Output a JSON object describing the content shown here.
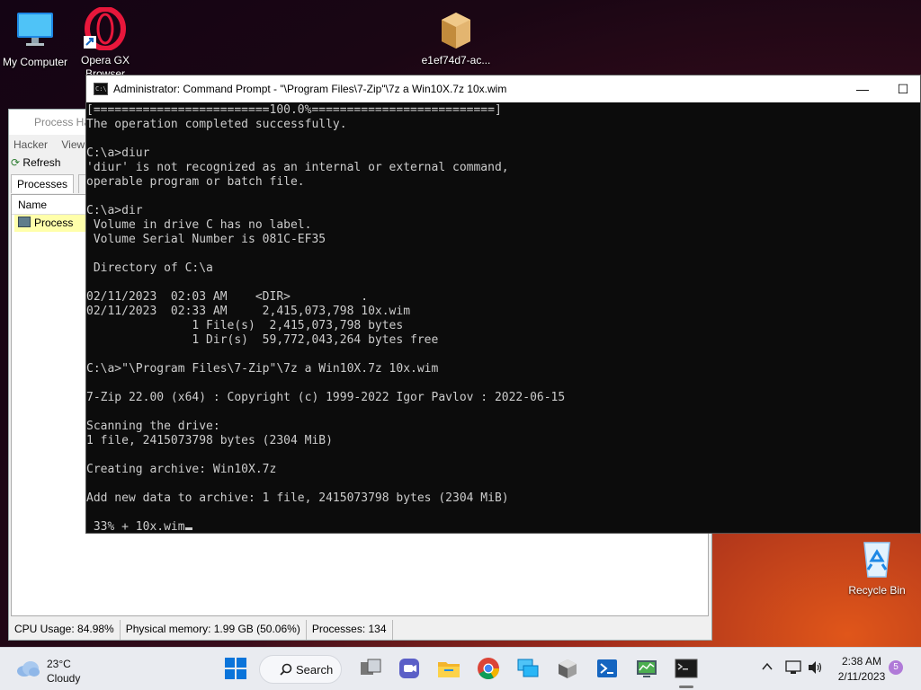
{
  "desktop": {
    "icons": [
      {
        "label": "My Computer",
        "icon": "monitor-icon"
      },
      {
        "label": "Opera GX\nBrowser",
        "icon": "opera-icon"
      },
      {
        "label": "e1ef74d7-ac...",
        "icon": "package-box-icon"
      },
      {
        "label": "Recycle Bin",
        "icon": "recycle-bin-icon"
      }
    ]
  },
  "process_hacker": {
    "title": "Process Ha",
    "menu": [
      "Hacker",
      "View"
    ],
    "toolbar_refresh": "Refresh",
    "tabs": [
      "Processes",
      "Ser"
    ],
    "column_name": "Name",
    "row_label": "Process",
    "status": {
      "cpu": "CPU Usage: 84.98%",
      "memory": "Physical memory: 1.99 GB (50.06%)",
      "processes": "Processes: 134"
    }
  },
  "cmd": {
    "title": "Administrator:  Command Prompt - \"\\Program Files\\7-Zip\"\\7z  a Win10X.7z 10x.wim",
    "minimize": "—",
    "maximize": "☐",
    "lines": [
      "[=========================100.0%==========================]",
      "The operation completed successfully.",
      "",
      "C:\\a>diur",
      "'diur' is not recognized as an internal or external command,",
      "operable program or batch file.",
      "",
      "C:\\a>dir",
      " Volume in drive C has no label.",
      " Volume Serial Number is 081C-EF35",
      "",
      " Directory of C:\\a",
      "",
      "02/11/2023  02:03 AM    <DIR>          .",
      "02/11/2023  02:33 AM     2,415,073,798 10x.wim",
      "               1 File(s)  2,415,073,798 bytes",
      "               1 Dir(s)  59,772,043,264 bytes free",
      "",
      "C:\\a>\"\\Program Files\\7-Zip\"\\7z a Win10X.7z 10x.wim",
      "",
      "7-Zip 22.00 (x64) : Copyright (c) 1999-2022 Igor Pavlov : 2022-06-15",
      "",
      "Scanning the drive:",
      "1 file, 2415073798 bytes (2304 MiB)",
      "",
      "Creating archive: Win10X.7z",
      "",
      "Add new data to archive: 1 file, 2415073798 bytes (2304 MiB)",
      "",
      " 33% + 10x.wim"
    ]
  },
  "taskbar": {
    "weather_temp": "23°C",
    "weather_desc": "Cloudy",
    "search_label": "Search",
    "clock_time": "2:38 AM",
    "clock_date": "2/11/2023",
    "notification_count": "5",
    "apps": [
      "windows-start-icon",
      "task-view-icon",
      "chat-icon",
      "file-explorer-icon",
      "chrome-icon",
      "remote-desktop-icon",
      "package-icon",
      "powershell-icon",
      "process-hacker-icon",
      "terminal-icon"
    ]
  },
  "colors": {
    "console_bg": "#0c0c0c",
    "console_text": "#cccccc",
    "taskbar_bg": "#e9ebf0",
    "highlight_row": "#ffffaa"
  }
}
